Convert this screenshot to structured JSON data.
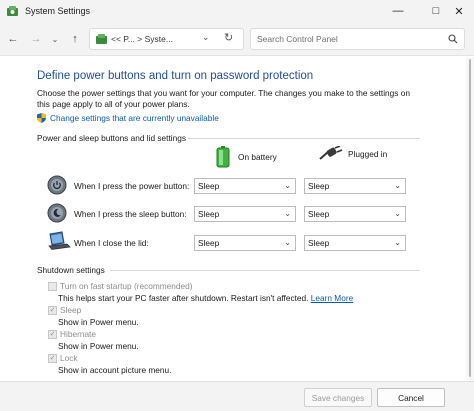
{
  "window": {
    "title": "System Settings"
  },
  "nav": {
    "address_text": "<< P... > Syste...",
    "search_placeholder": "Search Control Panel"
  },
  "page": {
    "heading": "Define power buttons and turn on password protection",
    "description": "Choose the power settings that you want for your computer. The changes you make to the settings on this page apply to all of your power plans.",
    "change_link": "Change settings that are currently unavailable"
  },
  "power_section": {
    "label": "Power and sleep buttons and lid settings",
    "col_battery": "On battery",
    "col_plugged": "Plugged in",
    "rows": [
      {
        "label": "When I press the power button:",
        "battery": "Sleep",
        "plugged": "Sleep"
      },
      {
        "label": "When I press the sleep button:",
        "battery": "Sleep",
        "plugged": "Sleep"
      },
      {
        "label": "When I close the lid:",
        "battery": "Sleep",
        "plugged": "Sleep"
      }
    ]
  },
  "shutdown_section": {
    "label": "Shutdown settings",
    "items": [
      {
        "label": "Turn on fast startup (recommended)",
        "checked": false,
        "desc": "This helps start your PC faster after shutdown. Restart isn't affected.",
        "link": "Learn More"
      },
      {
        "label": "Sleep",
        "checked": true,
        "desc": "Show in Power menu."
      },
      {
        "label": "Hibernate",
        "checked": true,
        "desc": "Show in Power menu."
      },
      {
        "label": "Lock",
        "checked": true,
        "desc": "Show in account picture menu."
      }
    ]
  },
  "footer": {
    "save_label": "Save changes",
    "cancel_label": "Cancel"
  },
  "icons": {
    "app": "control-panel-icon",
    "power_button": "power-button-icon",
    "sleep_button": "sleep-button-icon",
    "lid": "laptop-lid-icon",
    "battery": "battery-icon",
    "plug": "plug-icon",
    "shield": "uac-shield-icon"
  },
  "colors": {
    "heading": "#1f4e9c",
    "link": "#0b5bb5",
    "chrome": "#f3f3f3"
  }
}
